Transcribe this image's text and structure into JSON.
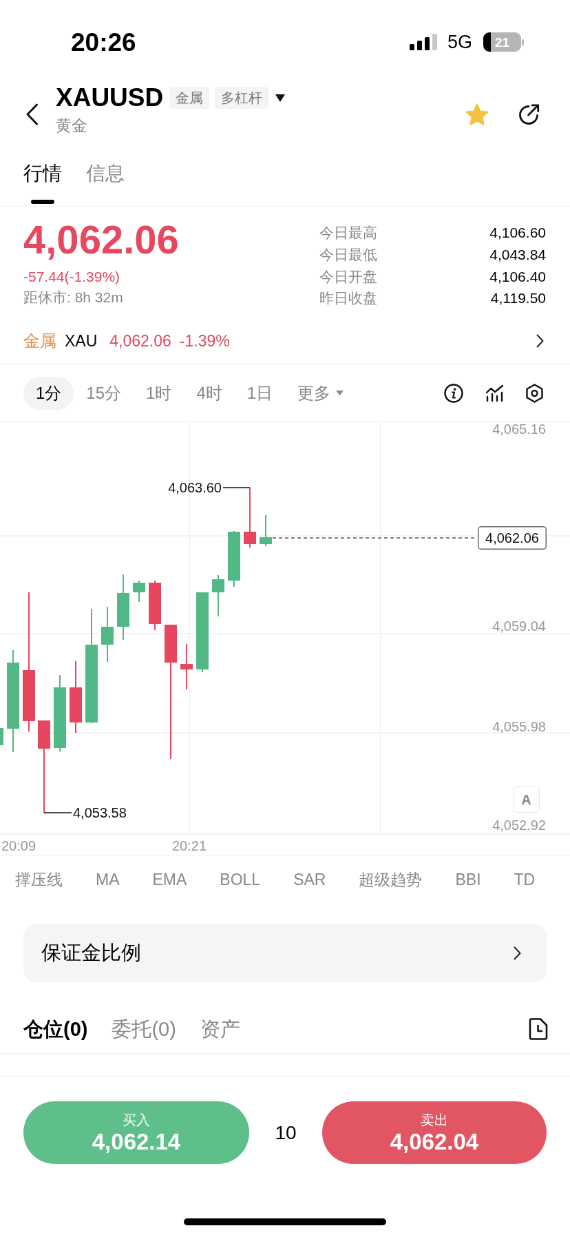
{
  "status_bar": {
    "time": "20:26",
    "network": "5G",
    "battery": "21"
  },
  "header": {
    "symbol": "XAUUSD",
    "tags": [
      "金属",
      "多杠杆"
    ],
    "name": "黄金",
    "favorite": true
  },
  "tabs": [
    {
      "label": "行情",
      "selected": true
    },
    {
      "label": "信息",
      "selected": false
    }
  ],
  "quote": {
    "price": "4,062.06",
    "change": "-57.44(-1.39%)",
    "close_countdown": "距休市: 8h 32m",
    "stats": [
      {
        "label": "今日最高",
        "value": "4,106.60"
      },
      {
        "label": "今日最低",
        "value": "4,043.84"
      },
      {
        "label": "今日开盘",
        "value": "4,106.40"
      },
      {
        "label": "昨日收盘",
        "value": "4,119.50"
      }
    ]
  },
  "underlying": {
    "category": "金属",
    "symbol": "XAU",
    "price": "4,062.06",
    "change": "-1.39%"
  },
  "timeframes": [
    {
      "label": "1分",
      "selected": true,
      "kind": "interval"
    },
    {
      "label": "15分",
      "selected": false,
      "kind": "interval"
    },
    {
      "label": "1时",
      "selected": false,
      "kind": "interval"
    },
    {
      "label": "4时",
      "selected": false,
      "kind": "interval"
    },
    {
      "label": "1日",
      "selected": false,
      "kind": "interval"
    },
    {
      "label": "更多",
      "selected": false,
      "kind": "menu"
    }
  ],
  "chart": {
    "y_labels": [
      "4,065.16",
      "4,059.04",
      "4,055.98",
      "4,052.92"
    ],
    "high_label": "4,063.60",
    "low_label": "4,053.58",
    "last_price": "4,062.06",
    "x_labels": [
      "20:09",
      "20:21"
    ],
    "scale_button": "A"
  },
  "indicators": [
    "撑压线",
    "MA",
    "EMA",
    "BOLL",
    "SAR",
    "超级趋势",
    "BBI",
    "TD"
  ],
  "margin_ratio": {
    "label": "保证金比例"
  },
  "position_tabs": [
    {
      "label": "仓位(0)",
      "selected": true
    },
    {
      "label": "委托(0)",
      "selected": false
    },
    {
      "label": "资产",
      "selected": false
    }
  ],
  "trade_bar": {
    "buy": {
      "label": "买入",
      "price": "4,062.14"
    },
    "quantity": "10",
    "sell": {
      "label": "卖出",
      "price": "4,062.04"
    }
  }
}
